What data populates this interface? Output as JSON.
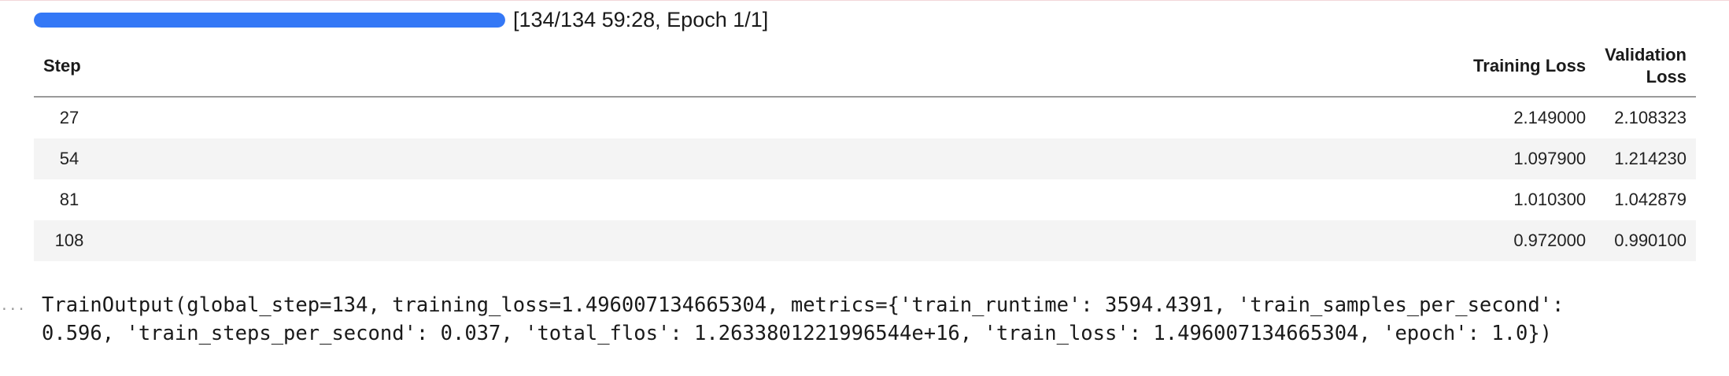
{
  "progress": {
    "fraction": 1.0,
    "text": "[134/134 59:28, Epoch 1/1]",
    "fill_color": "#3478f6"
  },
  "table": {
    "headers": {
      "step": "Step",
      "training_loss": "Training Loss",
      "validation_loss_line1": "Validation",
      "validation_loss_line2": "Loss"
    },
    "rows": [
      {
        "step": "27",
        "training_loss": "2.149000",
        "validation_loss": "2.108323"
      },
      {
        "step": "54",
        "training_loss": "1.097900",
        "validation_loss": "1.214230"
      },
      {
        "step": "81",
        "training_loss": "1.010300",
        "validation_loss": "1.042879"
      },
      {
        "step": "108",
        "training_loss": "0.972000",
        "validation_loss": "0.990100"
      }
    ]
  },
  "output": {
    "indicator": "...",
    "line1": "TrainOutput(global_step=134, training_loss=1.496007134665304, metrics={'train_runtime': 3594.4391, 'train_samples_per_second':",
    "line2": "0.596, 'train_steps_per_second': 0.037, 'total_flos': 1.2633801221996544e+16, 'train_loss': 1.496007134665304, 'epoch': 1.0})"
  }
}
